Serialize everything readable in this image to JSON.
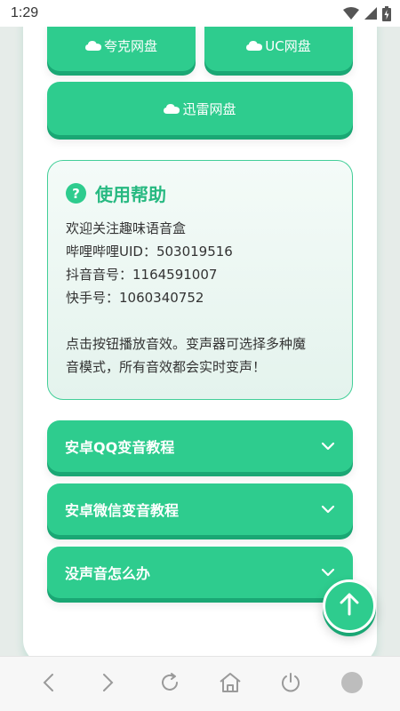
{
  "status_bar": {
    "time": "1:29"
  },
  "buttons": {
    "quark": "夸克网盘",
    "uc": "UC网盘",
    "xunlei": "迅雷网盘"
  },
  "help": {
    "icon_glyph": "?",
    "title": "使用帮助",
    "welcome": "欢迎关注趣味语音盒",
    "bilibili": "哔哩哔哩UID：503019516",
    "douyin": "抖音音号：1164591007",
    "kuaishou": "快手号：1060340752",
    "tip_line1": "点击按钮播放音效。变声器可选择多种魔",
    "tip_line2": "音模式，所有音效都会实时变声！"
  },
  "tutorials": [
    {
      "label": "安卓QQ变音教程"
    },
    {
      "label": "安卓微信变音教程"
    },
    {
      "label": "没声音怎么办"
    }
  ],
  "colors": {
    "accent": "#2ecc8e",
    "accent_dark": "#1aa774",
    "title_green": "#27b981"
  }
}
